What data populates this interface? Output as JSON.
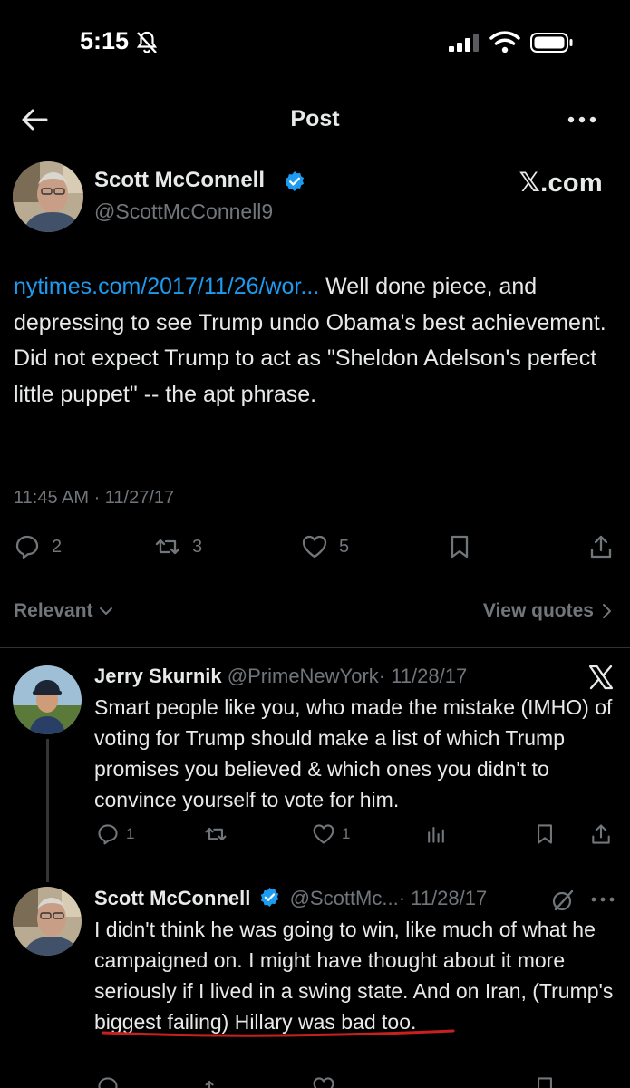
{
  "status_bar": {
    "time": "5:15",
    "icons": [
      "bell-off-icon",
      "signal-icon",
      "wifi-icon",
      "battery-icon"
    ]
  },
  "header": {
    "title": "Post",
    "back_icon": "arrow-left-icon",
    "more_icon": "more-horizontal-icon"
  },
  "watermark": "𝕏.com",
  "main_post": {
    "author_name": "Scott McConnell",
    "author_handle": "@ScottMcConnell9",
    "verified": true,
    "link_text": "nytimes.com/2017/11/26/wor...",
    "body_text": "  Well done piece, and depressing  to see Trump undo Obama's best achievement. Did not expect Trump to act as \"Sheldon Adelson's perfect little puppet\" -- the apt phrase.",
    "timestamp": "11:45 AM · 11/27/17",
    "replies": "2",
    "reposts": "3",
    "likes": "5"
  },
  "sort": {
    "relevant_label": "Relevant",
    "view_quotes_label": "View quotes"
  },
  "replies": [
    {
      "author_name": "Jerry Skurnik",
      "author_handle": "@PrimeNewYork",
      "date": "· 11/28/17",
      "body": "Smart people like you, who made the mistake (IMHO) of voting for Trump should make a list of which Trump promises you believed & which ones you didn't to convince yourself to vote for him.",
      "reply_count": "1",
      "like_count": "1"
    },
    {
      "author_name": "Scott McConnell",
      "author_handle": "@ScottMc...",
      "date": "· 11/28/17",
      "body_before": "I didn't think he was going to win, like much of what he campaigned on.  I might have thought about it more seriously if I lived in a swing state. ",
      "body_underlined": "And on Iran, (Trump's biggest failing",
      "body_after": ") Hillary was bad too."
    }
  ],
  "colors": {
    "background": "#000000",
    "text": "#e7e9ea",
    "muted": "#71767b",
    "link": "#1d9bf0",
    "verified": "#1d9bf0",
    "underline": "#c8201e"
  }
}
